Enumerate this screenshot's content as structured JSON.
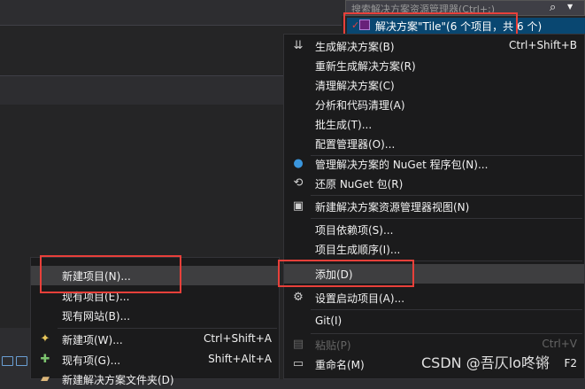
{
  "solution_explorer": {
    "search_placeholder": "搜索解决方案资源管理器(Ctrl+;)",
    "solution_label": "解决方案\"Tile\"(6 个项目，共 6 个)"
  },
  "main_menu": {
    "items": [
      {
        "label": "生成解决方案(B)",
        "shortcut": "Ctrl+Shift+B",
        "icon": "build-icon"
      },
      {
        "label": "重新生成解决方案(R)",
        "shortcut": ""
      },
      {
        "label": "清理解决方案(C)",
        "shortcut": ""
      },
      {
        "label": "分析和代码清理(A)",
        "shortcut": ""
      },
      {
        "label": "批生成(T)...",
        "shortcut": ""
      },
      {
        "label": "配置管理器(O)...",
        "shortcut": ""
      },
      {
        "label": "管理解决方案的 NuGet 程序包(N)...",
        "shortcut": "",
        "icon": "nuget-icon"
      },
      {
        "label": "还原 NuGet 包(R)",
        "shortcut": "",
        "icon": "restore-icon"
      },
      {
        "label": "新建解决方案资源管理器视图(N)",
        "shortcut": "",
        "icon": "new-view-icon"
      },
      {
        "label": "项目依赖项(S)...",
        "shortcut": ""
      },
      {
        "label": "项目生成顺序(I)...",
        "shortcut": ""
      },
      {
        "label": "添加(D)",
        "shortcut": ""
      },
      {
        "label": "设置启动项目(A)...",
        "shortcut": "",
        "icon": "gear-icon"
      },
      {
        "label": "Git(I)",
        "shortcut": ""
      },
      {
        "label": "粘贴(P)",
        "shortcut": "Ctrl+V",
        "icon": "paste-icon"
      },
      {
        "label": "重命名(M)",
        "shortcut": "F2",
        "icon": "rename-icon"
      }
    ]
  },
  "add_submenu": {
    "items": [
      {
        "label": "新建项目(N)...",
        "shortcut": ""
      },
      {
        "label": "现有项目(E)...",
        "shortcut": ""
      },
      {
        "label": "现有网站(B)...",
        "shortcut": ""
      },
      {
        "label": "新建项(W)...",
        "shortcut": "Ctrl+Shift+A",
        "icon": "new-item-icon"
      },
      {
        "label": "现有项(G)...",
        "shortcut": "Shift+Alt+A",
        "icon": "existing-item-icon"
      },
      {
        "label": "新建解决方案文件夹(D)",
        "shortcut": "",
        "icon": "folder-icon"
      }
    ]
  },
  "watermark": "CSDN @吾仄lo咚锵",
  "colors": {
    "highlight_box": "#e8403a",
    "selection": "#094771",
    "menu_bg": "#1b1b1c"
  }
}
